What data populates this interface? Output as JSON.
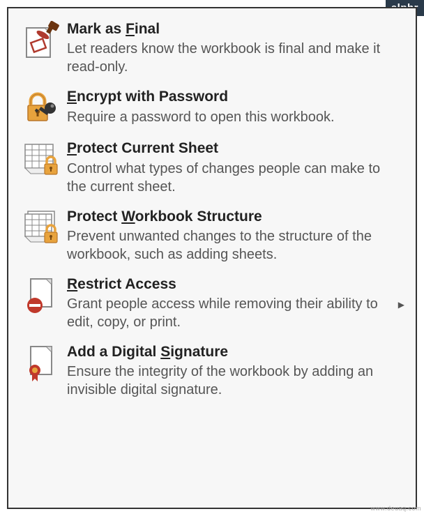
{
  "badge": "alphr",
  "watermark": "www.deuaq.com",
  "items": [
    {
      "title_pre": "Mark as ",
      "title_m": "F",
      "title_post": "inal",
      "desc": "Let readers know the workbook is final and make it read-only."
    },
    {
      "title_pre": "",
      "title_m": "E",
      "title_post": "ncrypt with Password",
      "desc": "Require a password to open this workbook."
    },
    {
      "title_pre": "",
      "title_m": "P",
      "title_post": "rotect Current Sheet",
      "desc": "Control what types of changes people can make to the current sheet."
    },
    {
      "title_pre": "Protect ",
      "title_m": "W",
      "title_post": "orkbook Structure",
      "desc": "Prevent unwanted changes to the structure of the workbook, such as adding sheets."
    },
    {
      "title_pre": "",
      "title_m": "R",
      "title_post": "estrict Access",
      "desc": "Grant people access while removing their ability to edit, copy, or print."
    },
    {
      "title_pre": "Add a Digital ",
      "title_m": "S",
      "title_post": "ignature",
      "desc": "Ensure the integrity of the workbook by adding an invisible digital signature."
    }
  ]
}
